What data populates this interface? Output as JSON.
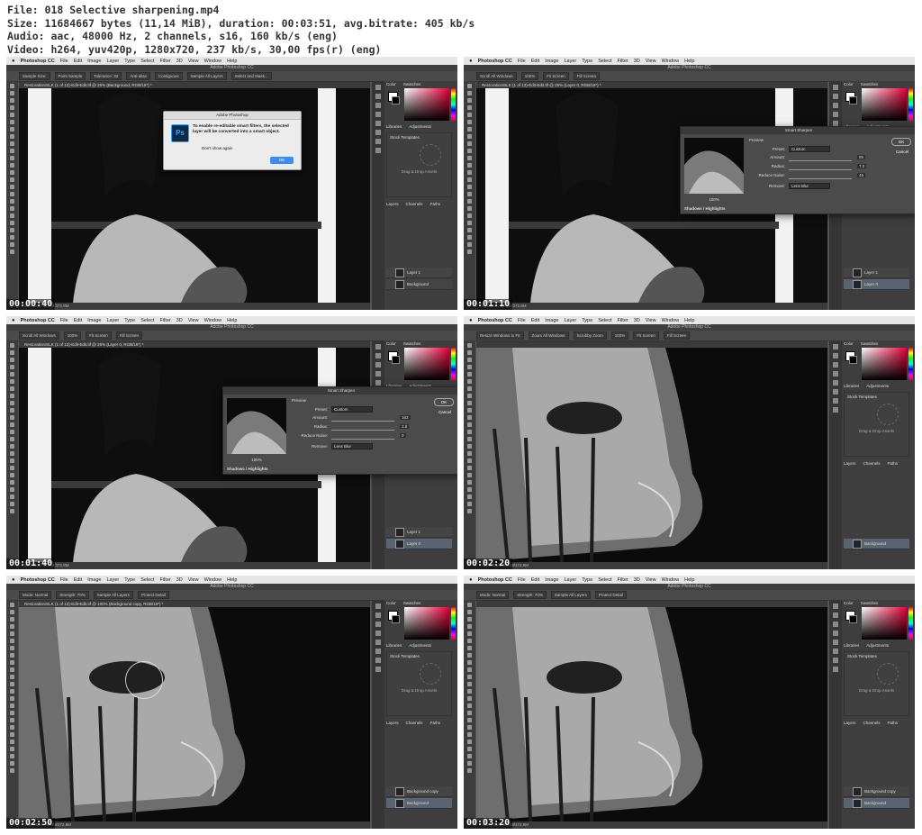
{
  "file_info": [
    "File: 018 Selective sharpening.mp4",
    "Size: 11684667 bytes (11,14 MiB), duration: 00:03:51, avg.bitrate: 405 kb/s",
    "Audio: aac, 48000 Hz, 2 channels, s16, 160 kb/s (eng)",
    "Video: h264, yuv420p, 1280x720, 237 kb/s, 30,00 fps(r) (eng)"
  ],
  "menu": {
    "app": "Photoshop CC",
    "items": [
      "File",
      "Edit",
      "Image",
      "Layer",
      "Type",
      "Select",
      "Filter",
      "3D",
      "View",
      "Window",
      "Help"
    ]
  },
  "window_title": "Adobe Photoshop CC",
  "panels": {
    "color_tabs": [
      "Color",
      "Swatches"
    ],
    "lib_tabs": [
      "Libraries",
      "Adjustments"
    ],
    "lib_select": "Stock Templates",
    "lib_drop": "Drag & Drop Assets",
    "layer_tabs": [
      "Layers",
      "Channels",
      "Paths"
    ]
  },
  "frames": [
    {
      "timestamp": "00:00:40",
      "doc": "RestorationSILK (1 of 13)-Edit-Edit.tif @ 25% (Background, RGB/16*) *",
      "options": [
        "Sample Size:",
        "Point Sample",
        "Tolerance: 32",
        "Anti-alias",
        "Contiguous",
        "Sample All Layers",
        "Select and Mask..."
      ],
      "status": "25%   Doc: 97.4M/372.8M",
      "layers": [
        "Layer 1",
        "Background"
      ],
      "alert": {
        "title": "Adobe Photoshop",
        "message": "To enable re-editable smart filters, the selected layer will be converted into a smart object.",
        "checkbox": "Don't show again",
        "ok": "OK"
      }
    },
    {
      "timestamp": "00:01:10",
      "doc": "RestorationSILK (1 of 13)-Edit-Edit.tif @ 25% (Layer 0, RGB/16*) *",
      "options": [
        "Scroll All Windows",
        "100%",
        "Fit Screen",
        "Fill Screen"
      ],
      "status": "25%   Doc: 97.4M/372.8M",
      "layers": [
        "Layer 1",
        "Layer 0"
      ],
      "dialog": {
        "title": "Smart Sharpen",
        "preview": "Preview",
        "preset_label": "Preset:",
        "preset": "Custom",
        "amount_label": "Amount:",
        "amount": "85",
        "radius_label": "Radius:",
        "radius": "7.0",
        "noise_label": "Reduce Noise:",
        "noise": "45",
        "remove_label": "Remove:",
        "remove": "Lens Blur",
        "zoom": "100%",
        "ok": "OK",
        "cancel": "Cancel",
        "shadows": "Shadows / Highlights"
      }
    },
    {
      "timestamp": "00:01:40",
      "doc": "RestorationSILK (1 of 13)-Edit-Edit.tif @ 25% (Layer 0, RGB/16*) *",
      "options": [
        "Scroll All Windows",
        "100%",
        "Fit Screen",
        "Fill Screen"
      ],
      "status": "25%   Doc: 97.4M/372.8M",
      "layers": [
        "Layer 1",
        "Layer 0"
      ],
      "dialog": {
        "title": "Smart Sharpen",
        "preview": "Preview",
        "preset_label": "Preset:",
        "preset": "Custom",
        "amount_label": "Amount:",
        "amount": "163",
        "radius_label": "Radius:",
        "radius": "3.8",
        "noise_label": "Reduce Noise:",
        "noise": "0",
        "remove_label": "Remove:",
        "remove": "Lens Blur",
        "zoom": "100%",
        "ok": "OK",
        "cancel": "Cancel",
        "shadows": "Shadows / Highlights"
      }
    },
    {
      "timestamp": "00:02:20",
      "doc": "",
      "options": [
        "Resize Windows to Fit",
        "Zoom All Windows",
        "Scrubby Zoom",
        "100%",
        "Fit Screen",
        "Fill Screen"
      ],
      "status": "100%   Doc: 97.4M/372.8M",
      "layers": [
        "Background"
      ]
    },
    {
      "timestamp": "00:02:50",
      "doc": "RestorationSILK (1 of 13)-Edit-Edit.tif @ 100% (Background copy, RGB/16*) *",
      "options": [
        "Mode: Normal",
        "Strength: 70%",
        "Sample All Layers",
        "Protect Detail"
      ],
      "status": "100%   Doc: 97.4M/372.8M",
      "layers": [
        "Background copy",
        "Background"
      ]
    },
    {
      "timestamp": "00:03:20",
      "doc": "",
      "options": [
        "Mode: Normal",
        "Strength: 70%",
        "Sample All Layers",
        "Protect Detail"
      ],
      "status": "100%   Doc: 97.4M/372.8M",
      "layers": [
        "Background copy",
        "Background"
      ]
    }
  ],
  "colors": {
    "ui_dark": "#535353",
    "panel": "#3e3e3e",
    "menubar": "#e6e6e6",
    "ok_blue": "#3a8df7",
    "ps_blue": "#31a8ff"
  }
}
